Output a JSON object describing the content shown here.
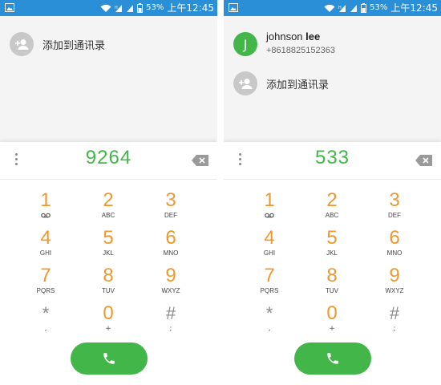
{
  "colors": {
    "status_bar": "#2a8fd6",
    "accent_green": "#43b649",
    "digit_orange": "#f0982f",
    "avatar_gray": "#c8c8c8"
  },
  "screens": [
    {
      "status_bar": {
        "battery": "53%",
        "time": "上午12:45",
        "icons": [
          "image-icon",
          "wifi-icon",
          "signal-icon",
          "signal-icon",
          "battery-icon"
        ]
      },
      "contacts": [],
      "add_contact_label": "添加到通讯录",
      "dialed_number": "9264"
    },
    {
      "status_bar": {
        "battery": "53%",
        "time": "上午12:45",
        "icons": [
          "image-icon",
          "wifi-icon",
          "signal-icon",
          "signal-icon",
          "battery-icon"
        ]
      },
      "contacts": [
        {
          "initial": "J",
          "name_first": "johnson",
          "name_last": "lee",
          "number": "+8618825152363"
        }
      ],
      "add_contact_label": "添加到通讯录",
      "dialed_number": "533"
    }
  ],
  "keypad": [
    {
      "digit": "1",
      "letters": "",
      "icon": "voicemail-icon"
    },
    {
      "digit": "2",
      "letters": "ABC"
    },
    {
      "digit": "3",
      "letters": "DEF"
    },
    {
      "digit": "4",
      "letters": "GHI"
    },
    {
      "digit": "5",
      "letters": "JKL"
    },
    {
      "digit": "6",
      "letters": "MNO"
    },
    {
      "digit": "7",
      "letters": "PQRS"
    },
    {
      "digit": "8",
      "letters": "TUV"
    },
    {
      "digit": "9",
      "letters": "WXYZ"
    },
    {
      "digit": "*",
      "letters": ","
    },
    {
      "digit": "0",
      "letters": "+"
    },
    {
      "digit": "#",
      "letters": ";"
    }
  ]
}
